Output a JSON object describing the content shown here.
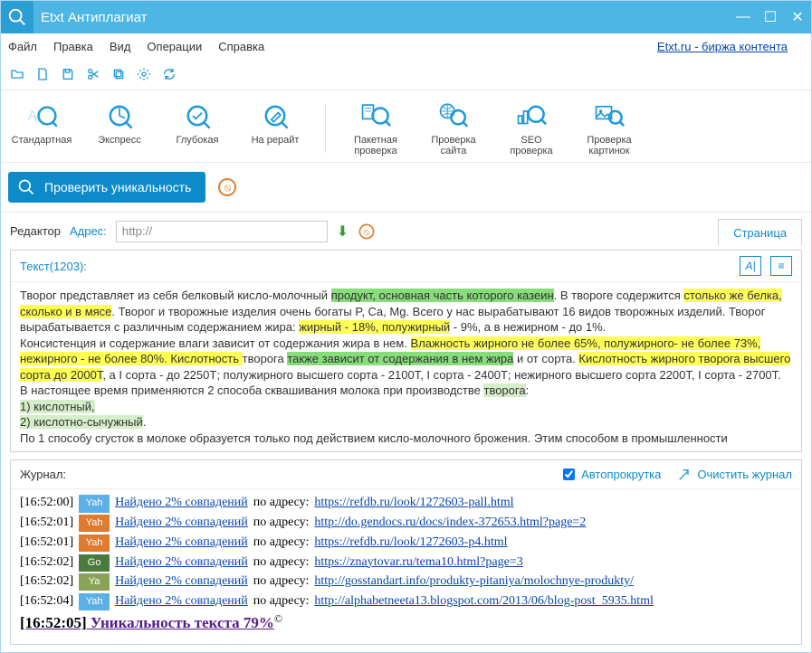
{
  "window": {
    "title": "Etxt Антиплагиат"
  },
  "menu": {
    "items": [
      "Файл",
      "Правка",
      "Вид",
      "Операции",
      "Справка"
    ],
    "right_link": "Etxt.ru - биржа контента"
  },
  "small_toolbar": {
    "icons": [
      "folder-open-icon",
      "document-icon",
      "save-icon",
      "scissors-icon",
      "copy-icon",
      "settings-icon",
      "refresh-icon"
    ]
  },
  "big_toolbar": {
    "left": [
      {
        "label": "Стандартная"
      },
      {
        "label": "Экспресс"
      },
      {
        "label": "Глубокая"
      },
      {
        "label": "На рерайт"
      }
    ],
    "right": [
      {
        "label": "Пакетная\nпроверка"
      },
      {
        "label": "Проверка\nсайта"
      },
      {
        "label": "SEO\nпроверка"
      },
      {
        "label": "Проверка\nкартинок"
      }
    ]
  },
  "check_button": "Проверить уникальность",
  "editor": {
    "label": "Редактор",
    "address_label": "Адрес:",
    "url_value": "http://",
    "tab_label": "Страница",
    "counter_label": "Текст(1203):"
  },
  "log": {
    "title": "Журнал:",
    "auto_scroll": "Автопрокрутка",
    "auto_scroll_checked": true,
    "clear": "Очистить журнал",
    "found_text": "Найдено 2% совпадений",
    "at_text": " по адресу: ",
    "rows": [
      {
        "ts": "[16:52:00]",
        "eng": "Yah",
        "color": "#5bb0e8",
        "url": "https://refdb.ru/look/1272603-pall.html"
      },
      {
        "ts": "[16:52:01]",
        "eng": "Yah",
        "color": "#e07b2e",
        "url": "http://do.gendocs.ru/docs/index-372653.html?page=2"
      },
      {
        "ts": "[16:52:01]",
        "eng": "Yah",
        "color": "#e07b2e",
        "url": "https://refdb.ru/look/1272603-p4.html"
      },
      {
        "ts": "[16:52:02]",
        "eng": "Go",
        "color": "#4a7a3c",
        "url": "https://znaytovar.ru/tema10.html?page=3"
      },
      {
        "ts": "[16:52:02]",
        "eng": "Ya",
        "color": "#8aa357",
        "url": "http://gosstandart.info/produkty-pitaniya/molochnye-produkty/"
      },
      {
        "ts": "[16:52:04]",
        "eng": "Yah",
        "color": "#5bb0e8",
        "url": "http://alphabetneeta13.blogspot.com/2013/06/blog-post_5935.html"
      }
    ],
    "final": {
      "ts": "[16:52:05]",
      "text": "Уникальность текста 79%"
    }
  },
  "text_body": {
    "p1_a": "Творог представляет из себя белковый кисло-молочный ",
    "p1_b": "продукт, основная часть которого казеин",
    "p1_c": ". В твороге содержится ",
    "p1_d": "столько же белка, сколько и в мясе",
    "p1_e": ". Творог и творожные изделия очень богаты P, Ca, Mg. Всего у нас вырабатывают 16 видов творожных изделий. Творог вырабатывается с различным содержанием жира: ",
    "p1_f": "жирный - 18%, полужирный",
    "p1_g": " - 9%, а в нежирном - до 1%.",
    "p2_a": "Консистенция и содержание влаги зависит от содержания жира в нем. ",
    "p2_b": "Влажность жирного не более 65%, полужирного- не более 73%, нежирного - не более 80%. Кислотность ",
    "p2_c": "творога ",
    "p2_d": "также зависит от содержания в нем жира",
    "p2_e": " и от сорта. ",
    "p2_f": "Кислотность жирного творога высшего сорта до 2000Т",
    "p2_g": ", а I сорта - до 2250Т; полужирного высшего сорта - 2100Т, I сорта - 2400Т; нежирного высшего сорта 2200Т, I сорта - 2700Т.",
    "p3_a": "В настоящее время применяются 2 способа сквашивания молока при производстве ",
    "p3_b": "творога",
    "p3_c": ":",
    "p4": "1) кислотный,",
    "p5": "2) кислотно-сычужный",
    "p5_c": ".",
    "p6_a": "По 1 способу сгусток в молоке образуется только под действием кисло-молочного брожения. Этим способом в промышленности"
  }
}
